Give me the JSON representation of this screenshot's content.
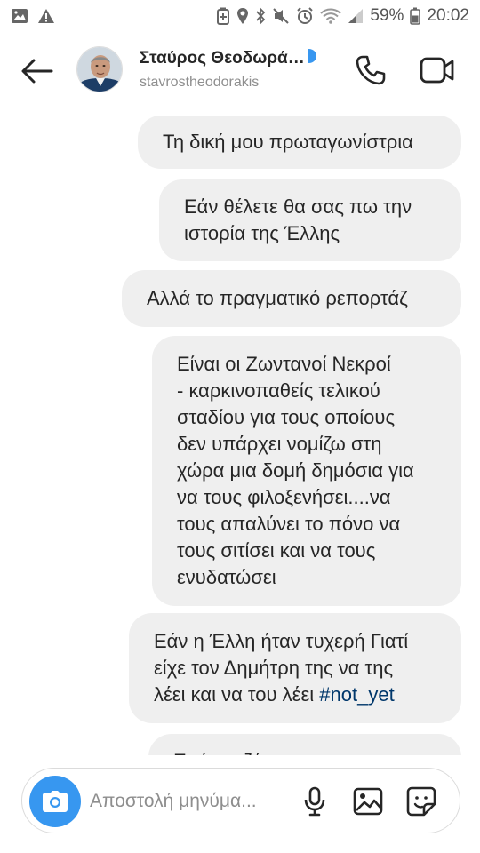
{
  "status_bar": {
    "battery": "59%",
    "time": "20:02"
  },
  "header": {
    "contact_name": "Σταύρος Θεοδωρά…",
    "username": "stavrostheodorakis",
    "icons": [
      "back-arrow-icon",
      "phone-icon",
      "video-camera-icon"
    ]
  },
  "messages": [
    {
      "text": "Τη δική μου πρωταγωνίστρια"
    },
    {
      "lines": [
        "Εάν θέλετε θα σας πω την",
        "ιστορία της Έλλης"
      ]
    },
    {
      "text": "Αλλά το πραγματικό ρεπορτάζ"
    },
    {
      "lines": [
        "Είναι οι Ζωντανοί Νεκροί",
        "- καρκινοπαθείς τελικού",
        "σταδίου για τους οποίους",
        "δεν υπάρχει νομίζω στη",
        "χώρα μια δομή δημόσια για",
        "να τους φιλοξενήσει....να",
        "τους απαλύνει το πόνο να",
        "τους σιτίσει και να τους",
        "ενυδατώσει"
      ]
    },
    {
      "lines": [
        "Εάν η Έλλη ήταν τυχερή Γιατί",
        "είχε τον Δημήτρη της να της",
        "λέει και να του λέει "
      ],
      "hashtag": "#not_yet"
    },
    {
      "text": "Εγώ να ζήσω"
    }
  ],
  "composer": {
    "placeholder": "Αποστολή μηνύμα...",
    "icons": [
      "camera-icon",
      "microphone-icon",
      "gallery-icon",
      "sticker-icon"
    ]
  },
  "colors": {
    "accent": "#3797f0",
    "bubble": "#efefef",
    "hashtag": "#00376b",
    "verified": "#3897f0"
  }
}
